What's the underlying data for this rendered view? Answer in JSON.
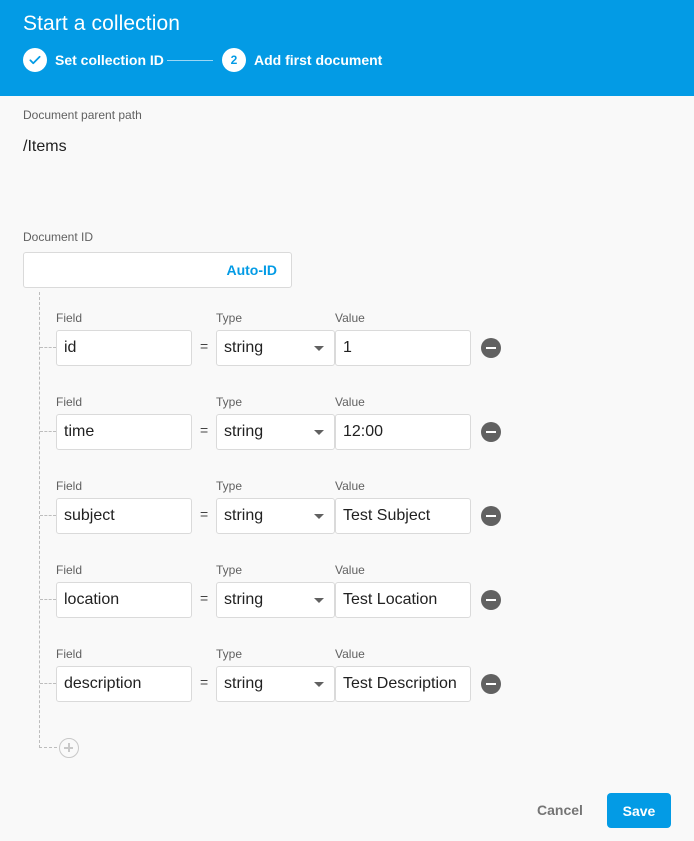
{
  "header": {
    "title": "Start a collection",
    "steps": [
      {
        "marker": "✓",
        "label": "Set collection ID"
      },
      {
        "marker": "2",
        "label": "Add first document"
      }
    ]
  },
  "parent_path": {
    "label": "Document parent path",
    "value": "/Items"
  },
  "document_id": {
    "label": "Document ID",
    "value": "",
    "auto_id_label": "Auto-ID"
  },
  "fields": [
    {
      "field_label": "Field",
      "type_label": "Type",
      "value_label": "Value",
      "field": "id",
      "eq": "=",
      "type": "string",
      "value": "1"
    },
    {
      "field_label": "Field",
      "type_label": "Type",
      "value_label": "Value",
      "field": "time",
      "eq": "=",
      "type": "string",
      "value": "12:00"
    },
    {
      "field_label": "Field",
      "type_label": "Type",
      "value_label": "Value",
      "field": "subject",
      "eq": "=",
      "type": "string",
      "value": "Test Subject"
    },
    {
      "field_label": "Field",
      "type_label": "Type",
      "value_label": "Value",
      "field": "location",
      "eq": "=",
      "type": "string",
      "value": "Test Location"
    },
    {
      "field_label": "Field",
      "type_label": "Type",
      "value_label": "Value",
      "field": "description",
      "eq": "=",
      "type": "string",
      "value": "Test Description"
    }
  ],
  "actions": {
    "cancel_label": "Cancel",
    "save_label": "Save"
  },
  "colors": {
    "accent": "#039be5",
    "icon_gray": "#616161"
  }
}
